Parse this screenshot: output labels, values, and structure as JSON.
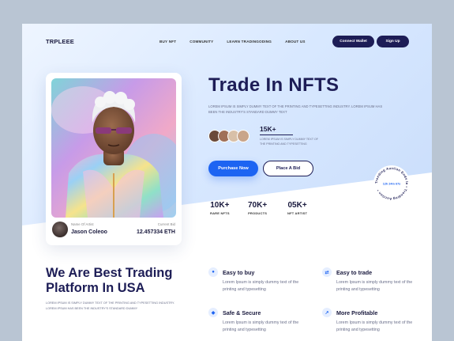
{
  "logo": "TRPLEEE",
  "nav": {
    "links": [
      "BUY NFT",
      "COMMUNITY",
      "LEARN TRADINGODING",
      "ABOUT US"
    ],
    "connect_wallet": "Connect Wallet",
    "sign_up": "Sign Up"
  },
  "hero": {
    "title": "Trade In NFTS",
    "description": "LOREM IPSUM IS SIMPLY DUMMY TEXT OF THE PRINTING AND TYPESETTING INDUSTRY. LOREM IPSUM HAS BEEN THE INDUSTRY'S STANDARD DUMMY TEXT",
    "people_count": "15K+",
    "people_desc": "LOREM IPSUM IS SIMPLY DUMMY TEXT OF THE PRINTING AND TYPESETTING",
    "purchase_button": "Purchase Now",
    "bid_button": "Place A Bid",
    "stats": [
      {
        "value": "10K+",
        "label": "RARE NFTS"
      },
      {
        "value": "70K+",
        "label": "PRODUCTS"
      },
      {
        "value": "05K+",
        "label": "NFT ARTIST"
      }
    ],
    "badge_ring_text": "Trending Auction Ends In • Trending Auction •",
    "badge_time": "12h 24m 67s"
  },
  "card": {
    "artist_label": "Name Of Artist",
    "artist_name": "Jason Coleoo",
    "bid_label": "Current Bid",
    "bid_value": "12.457334 ETH"
  },
  "section": {
    "title_line1": "We Are Best Trading",
    "title_line2": "Platform In USA",
    "description": "LOREM IPSUM IS SIMPLY DUMMY TEXT OF THE PRINTING AND TYPESETTING INDUSTRY. LOREM IPSUM HAS BEEN THE INDUSTRY'S STANDARD DUMMY",
    "features": [
      {
        "title": "Easy to buy",
        "desc": "Lorem Ipsum is simply dummy text of the printing and typesetting",
        "icon": "coin-icon"
      },
      {
        "title": "Easy to trade",
        "desc": "Lorem Ipsum is simply dummy text of the printing and typesetting",
        "icon": "swap-icon"
      },
      {
        "title": "Safe & Secure",
        "desc": "Lorem Ipsum is simply dummy text of the printing and typesetting",
        "icon": "shield-icon"
      },
      {
        "title": "More Profitable",
        "desc": "Lorem Ipsum is simply dummy text of the printing and typesetting",
        "icon": "chart-icon"
      }
    ]
  },
  "colors": {
    "navy": "#1d1d56",
    "blue": "#1d64f2",
    "page_bg": "#b9c5d3"
  }
}
